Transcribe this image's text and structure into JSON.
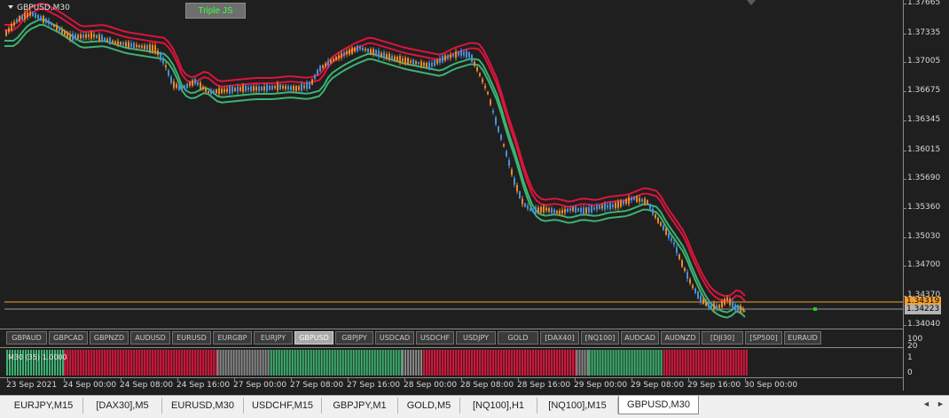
{
  "chart": {
    "symbol_title": "GBPUSD,M30",
    "strategy_button": "Triple JS",
    "colors": {
      "background": "#1f1f1f",
      "bull_candle": "#4a90d9",
      "bear_candle": "#e8892e",
      "red_band": "#dc143c",
      "green_band": "#3cb371",
      "bid_line": "#f0a030",
      "ask_line": "#9a9a9a"
    },
    "price_axis": {
      "labels": [
        "1.37665",
        "1.37335",
        "1.37005",
        "1.36675",
        "1.36345",
        "1.36015",
        "1.35690",
        "1.35360",
        "1.35030",
        "1.34700",
        "1.34370",
        "1.34040"
      ],
      "bid_tag": "1.34319",
      "ask_tag": "1.34223"
    },
    "indicator": {
      "title": "M30 (35) 1.0000",
      "axis_labels": [
        "100",
        "20",
        "1",
        "0"
      ],
      "segments": [
        {
          "color": "#3cb371",
          "units": 65
        },
        {
          "color": "#dc143c",
          "units": 172
        },
        {
          "color": "#8a8a8a",
          "units": 60
        },
        {
          "color": "#3cb371",
          "units": 148
        },
        {
          "color": "#8a8a8a",
          "units": 24
        },
        {
          "color": "#dc143c",
          "units": 172
        },
        {
          "color": "#8a8a8a",
          "units": 14
        },
        {
          "color": "#3cb371",
          "units": 84
        },
        {
          "color": "#dc143c",
          "units": 96
        }
      ]
    },
    "time_axis": {
      "labels": [
        "23 Sep 2021",
        "24 Sep 00:00",
        "24 Sep 08:00",
        "24 Sep 16:00",
        "27 Sep 00:00",
        "27 Sep 08:00",
        "27 Sep 16:00",
        "28 Sep 00:00",
        "28 Sep 08:00",
        "28 Sep 16:00",
        "29 Sep 00:00",
        "29 Sep 08:00",
        "29 Sep 16:00",
        "30 Sep 00:00"
      ]
    },
    "symbol_buttons": [
      {
        "label": "GBPAUD",
        "active": false
      },
      {
        "label": "GBPCAD",
        "active": false
      },
      {
        "label": "GBPNZD",
        "active": false
      },
      {
        "label": "AUDUSD",
        "active": false
      },
      {
        "label": "EURUSD",
        "active": false
      },
      {
        "label": "EURGBP",
        "active": false
      },
      {
        "label": "EURJPY",
        "active": false
      },
      {
        "label": "GBPUSD",
        "active": true
      },
      {
        "label": "GBPJPY",
        "active": false
      },
      {
        "label": "USDCAD",
        "active": false
      },
      {
        "label": "USDCHF",
        "active": false
      },
      {
        "label": "USDJPY",
        "active": false
      },
      {
        "label": "GOLD",
        "active": false
      },
      {
        "label": "[DAX40]",
        "active": false
      },
      {
        "label": "[NQ100]",
        "active": false
      },
      {
        "label": "AUDCAD",
        "active": false
      },
      {
        "label": "AUDNZD",
        "active": false
      },
      {
        "label": "[DJI30]",
        "active": false
      },
      {
        "label": "[SP500]",
        "active": false
      },
      {
        "label": "EURAUD",
        "active": false
      }
    ]
  },
  "tabs": [
    {
      "label": "EURJPY,M15",
      "active": false
    },
    {
      "label": "[DAX30],M5",
      "active": false
    },
    {
      "label": "EURUSD,M30",
      "active": false
    },
    {
      "label": "USDCHF,M15",
      "active": false
    },
    {
      "label": "GBPJPY,M1",
      "active": false
    },
    {
      "label": "GOLD,M5",
      "active": false
    },
    {
      "label": "[NQ100],H1",
      "active": false
    },
    {
      "label": "[NQ100],M15",
      "active": false
    },
    {
      "label": "GBPUSD,M30",
      "active": true
    }
  ],
  "tab_arrows": {
    "left": "◄",
    "right": "►"
  }
}
